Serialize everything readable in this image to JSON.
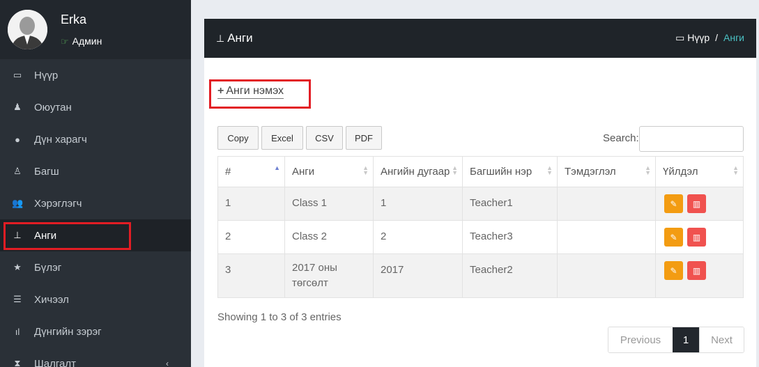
{
  "user": {
    "name": "Erka",
    "role": "Админ"
  },
  "sidebar": {
    "items": [
      {
        "label": "Нүүр",
        "icon": "laptop-icon"
      },
      {
        "label": "Оюутан",
        "icon": "student-icon"
      },
      {
        "label": "Дүн харагч",
        "icon": "user-icon"
      },
      {
        "label": "Багш",
        "icon": "teacher-icon"
      },
      {
        "label": "Хэрэглэгч",
        "icon": "users-icon"
      },
      {
        "label": "Анги",
        "icon": "sitemap-icon"
      },
      {
        "label": "Бүлэг",
        "icon": "star-icon"
      },
      {
        "label": "Хичээл",
        "icon": "book-icon"
      },
      {
        "label": "Дүнгийн зэрэг",
        "icon": "signal-icon"
      },
      {
        "label": "Шалгалт",
        "icon": "hourglass-icon"
      }
    ]
  },
  "header": {
    "title": "Анги",
    "breadcrumb": {
      "home": "Нүүр",
      "separator": "/",
      "current": "Анги"
    }
  },
  "add_button": {
    "label": "Анги нэмэх"
  },
  "export_buttons": [
    "Copy",
    "Excel",
    "CSV",
    "PDF"
  ],
  "search": {
    "label": "Search:",
    "value": ""
  },
  "table": {
    "headers": [
      "#",
      "Анги",
      "Ангийн дугаар",
      "Багшийн нэр",
      "Тэмдэглэл",
      "Үйлдэл"
    ],
    "rows": [
      [
        "1",
        "Class 1",
        "1",
        "Teacher1",
        ""
      ],
      [
        "2",
        "Class 2",
        "2",
        "Teacher3",
        ""
      ],
      [
        "3",
        "2017 оны төгсөлт",
        "2017",
        "Teacher2",
        ""
      ]
    ]
  },
  "footer": {
    "info": "Showing 1 to 3 of 3 entries",
    "pagination": {
      "previous": "Previous",
      "current_page": "1",
      "next": "Next"
    }
  },
  "colors": {
    "accent": "#4ac2c4",
    "highlight": "#e21d24",
    "edit": "#f39c12",
    "delete": "#f0524f"
  }
}
